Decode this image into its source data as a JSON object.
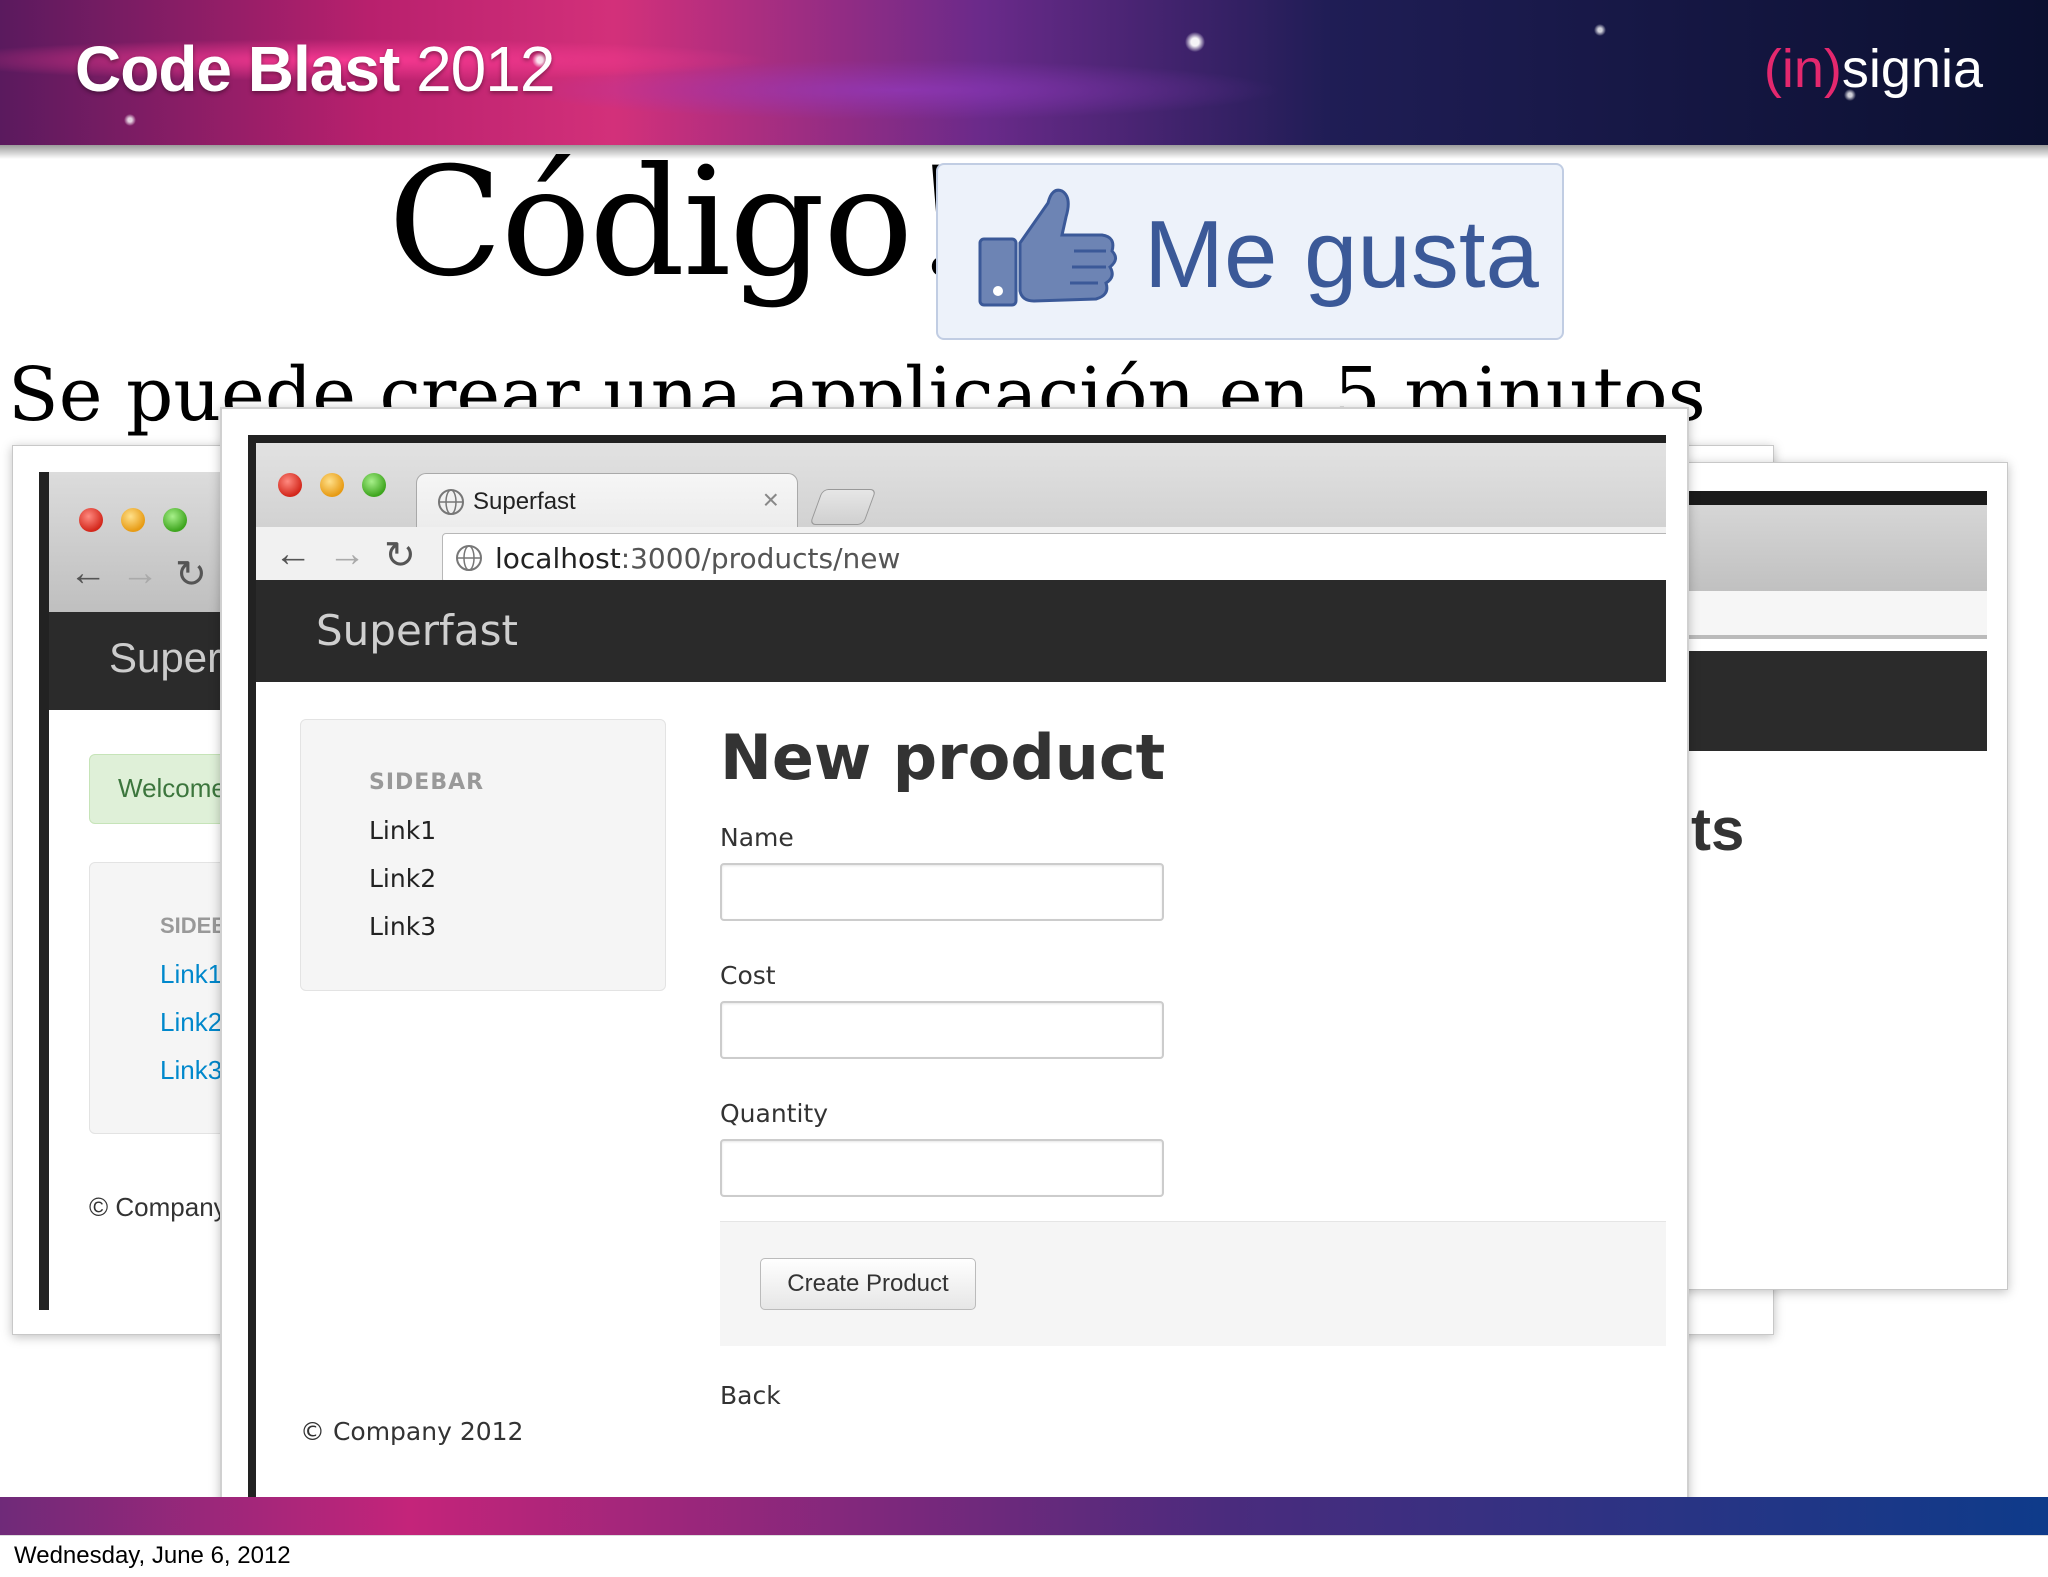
{
  "slide": {
    "brand_name": "Code Blast",
    "brand_year": "2012",
    "logo_paren": "(in)",
    "logo_rest": "signia",
    "title": "Código!",
    "like_label": "Me gusta",
    "subtitle": "Se puede crear una applicación en 5 minutos",
    "footer_date": "Wednesday, June 6, 2012"
  },
  "back_left_window": {
    "brand": "Superf",
    "welcome": "Welcome",
    "sidebar_header": "SIDEB",
    "links": [
      "Link1",
      "Link2",
      "Link3"
    ],
    "footer": "© Company"
  },
  "back_right_window": {
    "heading_fragment": "ts"
  },
  "browser": {
    "tab_title": "Superfast",
    "url_host": "localhost",
    "url_rest": ":3000/products/new",
    "icons": [
      "back-arrow-icon",
      "forward-arrow-icon",
      "reload-icon",
      "globe-icon",
      "close-icon"
    ]
  },
  "app": {
    "brand": "Superfast",
    "sidebar": {
      "header": "SIDEBAR",
      "links": [
        "Link1",
        "Link2",
        "Link3"
      ]
    },
    "page_title": "New product",
    "form": {
      "name_label": "Name",
      "cost_label": "Cost",
      "quantity_label": "Quantity",
      "name_value": "",
      "cost_value": "",
      "quantity_value": "",
      "submit_label": "Create Product"
    },
    "back_link": "Back",
    "footer": "© Company 2012"
  },
  "colors": {
    "like_blue": "#3b5998",
    "navbar": "#2a2a2a",
    "link_blue": "#0088cc",
    "accent_pink": "#e4286e"
  }
}
